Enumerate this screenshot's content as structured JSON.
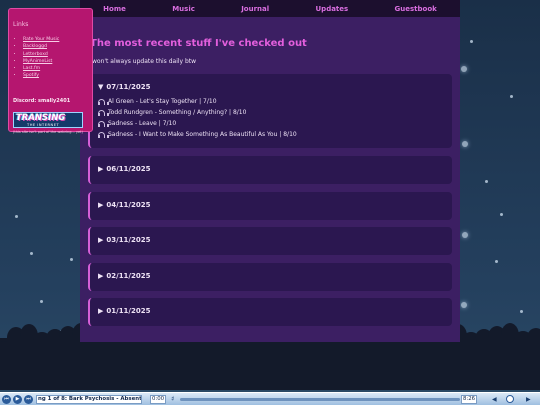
{
  "nav": {
    "items": [
      "Home",
      "Music",
      "Journal",
      "Updates",
      "Guestbook"
    ]
  },
  "main": {
    "title": "The most recent stuff I've checked out",
    "subtitle": "won't always update this daily btw",
    "entries": [
      {
        "date": "07/11/2025",
        "expanded": true,
        "tracks": [
          "Al Green - Let's Stay Together | 7/10",
          "Todd Rundgren - Something / Anything? | 8/10",
          "Sadness - Leave | 7/10",
          "Sadness - I Want to Make Something As Beautiful As You | 8/10"
        ]
      },
      {
        "date": "06/11/2025",
        "expanded": false
      },
      {
        "date": "04/11/2025",
        "expanded": false
      },
      {
        "date": "03/11/2025",
        "expanded": false
      },
      {
        "date": "02/11/2025",
        "expanded": false
      },
      {
        "date": "01/11/2025",
        "expanded": false
      }
    ],
    "arrow_open": "▼",
    "arrow_closed": "▶"
  },
  "sidebar": {
    "title": "Links",
    "links": [
      "Rate Your Music",
      "Backloggd",
      "Letterboxd",
      "MyAnimeList",
      "Last.fm",
      "Spotify"
    ],
    "discord": "Discord: smally2401",
    "badge_title": "TRANSING",
    "badge_sub": "THE INTERNET",
    "footer": "(this site isn't part of the webring... yet)"
  },
  "player": {
    "prev": "⏮",
    "play": "▶",
    "next": "⏭",
    "now_playing": "ng 1 of 8: Bark Psychosis - Absent F",
    "elapsed": "0:00",
    "duration": "8:26",
    "progress": 0.0
  },
  "colors": {
    "accent": "#e35fdd",
    "panel": "#3c1f63",
    "entry": "#2b1750",
    "sidebar": "#b5166f"
  }
}
